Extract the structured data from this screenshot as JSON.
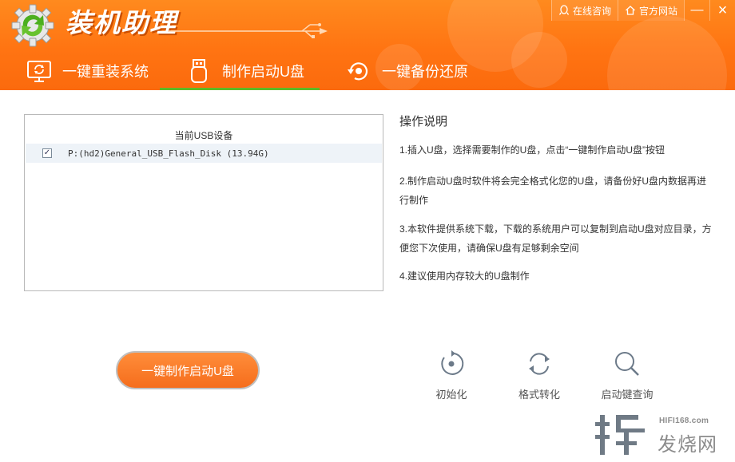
{
  "app": {
    "title": "装机助理"
  },
  "top_links": [
    {
      "label": "在线咨询",
      "icon": "qq-icon"
    },
    {
      "label": "官方网站",
      "icon": "home-icon"
    }
  ],
  "window_controls": {
    "minimize": "—",
    "close": "×"
  },
  "tabs": [
    {
      "label": "一键重装系统",
      "icon": "monitor-refresh-icon",
      "active": false
    },
    {
      "label": "制作启动U盘",
      "icon": "usb-drive-icon",
      "active": true
    },
    {
      "label": "一键备份还原",
      "icon": "backup-restore-icon",
      "active": false
    }
  ],
  "device_list": {
    "header": "当前USB设备",
    "items": [
      {
        "checked": true,
        "check_mark": "✓",
        "name": "P:(hd2)General_USB_Flash_Disk (13.94G)"
      }
    ]
  },
  "instructions": {
    "title": "操作说明",
    "steps": [
      "1.插入U盘，选择需要制作的U盘，点击“一键制作启动U盘”按钮",
      "2.制作启动U盘时软件将会完全格式化您的U盘，请备份好U盘内数据再进行制作",
      "3.本软件提供系统下载，下载的系统用户可以复制到启动U盘对应目录，方便您下次使用，请确保U盘有足够剩余空间",
      "4.建议使用内存较大的U盘制作"
    ]
  },
  "main_button": {
    "label": "一键制作启动U盘"
  },
  "tools": [
    {
      "label": "初始化",
      "icon": "initialize-icon"
    },
    {
      "label": "格式转化",
      "icon": "format-convert-icon"
    },
    {
      "label": "启动键查询",
      "icon": "search-icon"
    }
  ],
  "watermark": {
    "url": "HIFI168.com",
    "text": "发烧网"
  },
  "colors": {
    "header_orange": "#ff7412",
    "tab_underline": "#5dbb27",
    "button_orange": "#f56d1c"
  }
}
